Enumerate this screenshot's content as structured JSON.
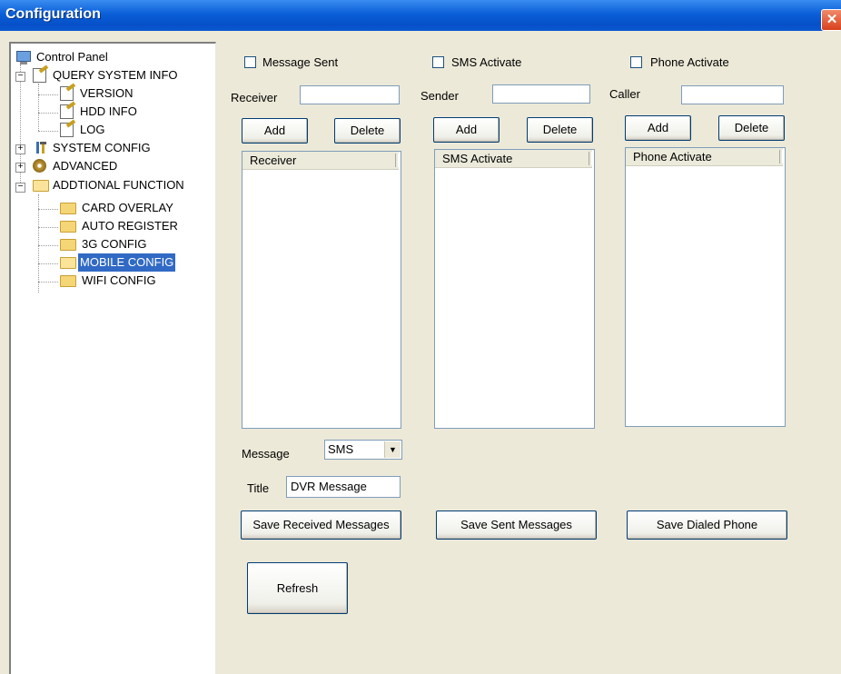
{
  "window": {
    "title": "Configuration",
    "close_glyph": "✕"
  },
  "tree": {
    "root": {
      "label": "Control Panel",
      "icon": "computer-icon"
    },
    "nodes": [
      {
        "label": "QUERY SYSTEM INFO",
        "icon": "document-edit-icon",
        "expanded": true
      },
      {
        "label": "VERSION",
        "icon": "document-edit-icon"
      },
      {
        "label": "HDD INFO",
        "icon": "document-edit-icon"
      },
      {
        "label": "LOG",
        "icon": "document-edit-icon"
      },
      {
        "label": "SYSTEM CONFIG",
        "icon": "tools-icon",
        "expanded": false
      },
      {
        "label": "ADVANCED",
        "icon": "gears-icon",
        "expanded": false
      },
      {
        "label": "ADDTIONAL FUNCTION",
        "icon": "folder-open-icon",
        "expanded": true
      },
      {
        "label": "CARD OVERLAY",
        "icon": "folder-icon"
      },
      {
        "label": "AUTO REGISTER",
        "icon": "folder-icon"
      },
      {
        "label": "3G CONFIG",
        "icon": "folder-icon"
      },
      {
        "label": "MOBILE CONFIG",
        "icon": "folder-open-icon",
        "selected": true
      },
      {
        "label": "WIFI CONFIG",
        "icon": "folder-icon"
      }
    ],
    "expand_glyph": "+",
    "collapse_glyph": "−"
  },
  "columns": {
    "message": {
      "checkbox_label": "Message Sent",
      "checked": false,
      "field_label": "Receiver",
      "field_value": "",
      "add_label": "Add",
      "delete_label": "Delete",
      "list_header": "Receiver",
      "save_label": "Save Received Messages"
    },
    "sms": {
      "checkbox_label": "SMS Activate",
      "checked": false,
      "field_label": "Sender",
      "field_value": "",
      "add_label": "Add",
      "delete_label": "Delete",
      "list_header": "SMS Activate",
      "save_label": "Save Sent Messages"
    },
    "phone": {
      "checkbox_label": "Phone Activate",
      "checked": false,
      "field_label": "Caller",
      "field_value": "",
      "add_label": "Add",
      "delete_label": "Delete",
      "list_header": "Phone Activate",
      "save_label": "Save Dialed Phone"
    }
  },
  "message_type": {
    "label": "Message",
    "value": "SMS"
  },
  "title_field": {
    "label": "Title",
    "value": "DVR Message"
  },
  "refresh_label": "Refresh",
  "colors": {
    "titlebar": "#0a5fd8",
    "selection": "#316ac5",
    "panel": "#ece9d8"
  }
}
